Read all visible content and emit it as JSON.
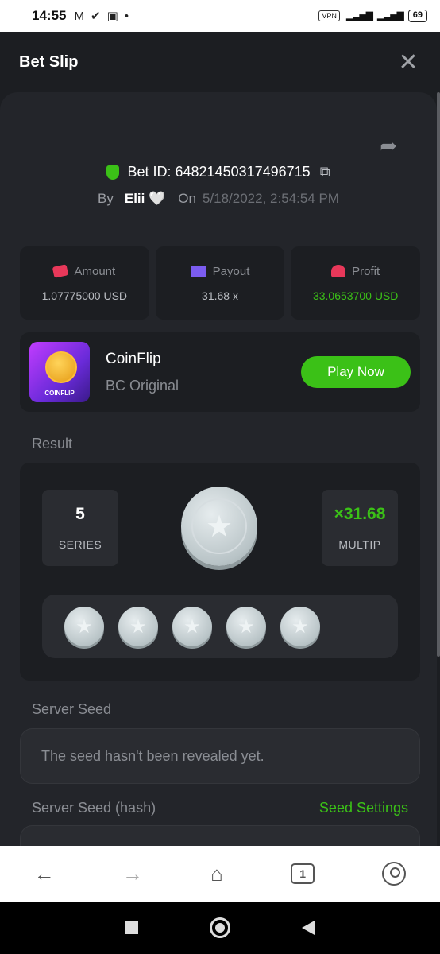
{
  "status_bar": {
    "time": "14:55",
    "vpn": "VPN",
    "network": "4G",
    "battery": "69"
  },
  "header": {
    "title": "Bet Slip",
    "close_icon": "close-icon"
  },
  "bet": {
    "id_label": "Bet ID:",
    "id_value": "64821450317496715",
    "by_label": "By",
    "user": "Elii 🤍",
    "on_label": "On",
    "date": "5/18/2022, 2:54:54 PM"
  },
  "stats": [
    {
      "label": "Amount",
      "value": "1.07775000 USD",
      "icon": "amount-icon"
    },
    {
      "label": "Payout",
      "value": "31.68 x",
      "icon": "payout-icon"
    },
    {
      "label": "Profit",
      "value": "33.0653700 USD",
      "icon": "profit-icon",
      "color": "#3bc117"
    }
  ],
  "game": {
    "name": "CoinFlip",
    "subtitle": "BC Original",
    "thumb_label": "COINFLIP",
    "play_label": "Play Now"
  },
  "result": {
    "label": "Result",
    "series_value": "5",
    "series_label": "SERIES",
    "multip_value": "×31.68",
    "multip_label": "MULTIP",
    "coins": [
      "star",
      "star",
      "star",
      "star",
      "star"
    ]
  },
  "server_seed": {
    "label": "Server Seed",
    "value": "The seed hasn't been revealed yet."
  },
  "server_seed_hash": {
    "label": "Server Seed (hash)",
    "settings_label": "Seed Settings"
  },
  "browser_nav": {
    "tabs_count": "1"
  },
  "colors": {
    "accent": "#3bc117",
    "background": "#1c1e22",
    "card": "#23252a"
  }
}
